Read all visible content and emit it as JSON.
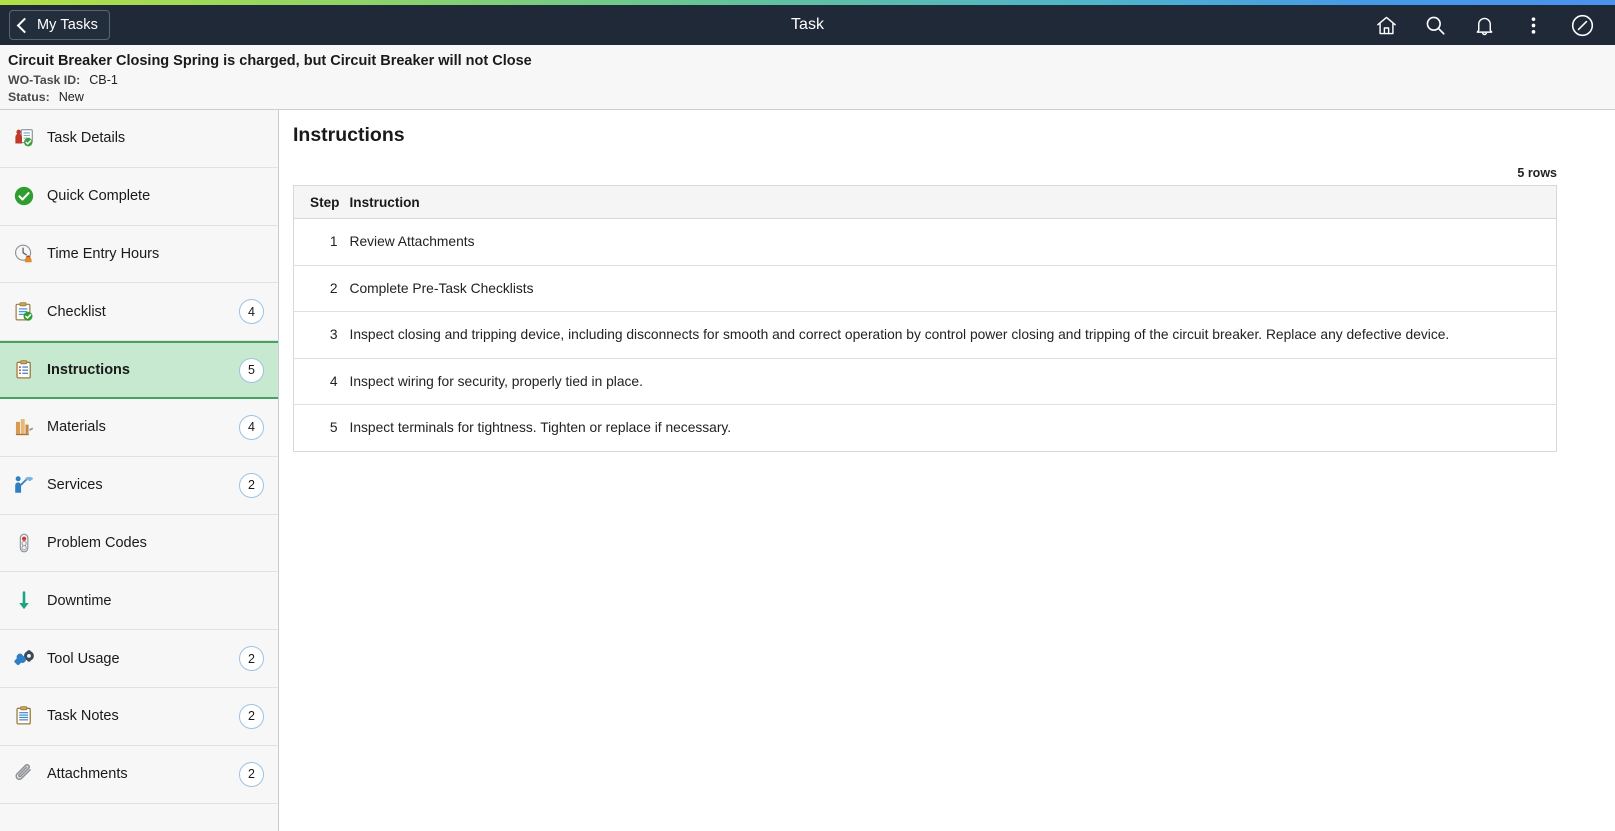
{
  "navbar": {
    "back_label": "My Tasks",
    "title": "Task",
    "icons": [
      "home-icon",
      "search-icon",
      "bell-icon",
      "more-vertical-icon",
      "compass-icon"
    ]
  },
  "task_header": {
    "title": "Circuit Breaker Closing Spring is charged, but Circuit Breaker will not Close",
    "wo_task_id_label": "WO-Task ID:",
    "wo_task_id_value": "CB-1",
    "status_label": "Status:",
    "status_value": "New"
  },
  "sidebar": {
    "items": [
      {
        "label": "Task Details",
        "icon": "task-details-icon",
        "badge": "",
        "active": false
      },
      {
        "label": "Quick Complete",
        "icon": "check-circle-icon",
        "badge": "",
        "active": false
      },
      {
        "label": "Time Entry Hours",
        "icon": "clock-icon",
        "badge": "",
        "active": false
      },
      {
        "label": "Checklist",
        "icon": "checklist-icon",
        "badge": "4",
        "active": false
      },
      {
        "label": "Instructions",
        "icon": "clipboard-icon",
        "badge": "5",
        "active": true
      },
      {
        "label": "Materials",
        "icon": "materials-icon",
        "badge": "4",
        "active": false
      },
      {
        "label": "Services",
        "icon": "services-icon",
        "badge": "2",
        "active": false
      },
      {
        "label": "Problem Codes",
        "icon": "traffic-light-icon",
        "badge": "",
        "active": false
      },
      {
        "label": "Downtime",
        "icon": "down-arrow-icon",
        "badge": "",
        "active": false
      },
      {
        "label": "Tool Usage",
        "icon": "tools-icon",
        "badge": "2",
        "active": false
      },
      {
        "label": "Task Notes",
        "icon": "notes-icon",
        "badge": "2",
        "active": false
      },
      {
        "label": "Attachments",
        "icon": "paperclip-icon",
        "badge": "2",
        "active": false
      }
    ]
  },
  "main": {
    "title": "Instructions",
    "rows_count": "5 rows",
    "table": {
      "columns": [
        "Step",
        "Instruction"
      ],
      "rows": [
        {
          "step": "1",
          "instruction": "Review Attachments"
        },
        {
          "step": "2",
          "instruction": "Complete Pre-Task Checklists"
        },
        {
          "step": "3",
          "instruction": "Inspect closing and tripping device, including disconnects for smooth and correct operation by control power closing and tripping of the circuit breaker.  Replace any defective device."
        },
        {
          "step": "4",
          "instruction": "Inspect wiring for security, properly tied in place."
        },
        {
          "step": "5",
          "instruction": "Inspect terminals for tightness.  Tighten or replace if necessary."
        }
      ]
    }
  },
  "colors": {
    "navbar_bg": "#1f2937",
    "active_item_bg": "#c7e9d0",
    "active_item_border": "#46a163",
    "gradient_start": "#b2e045",
    "gradient_end": "#4a92ef",
    "badge_border": "#9dc2e2"
  }
}
